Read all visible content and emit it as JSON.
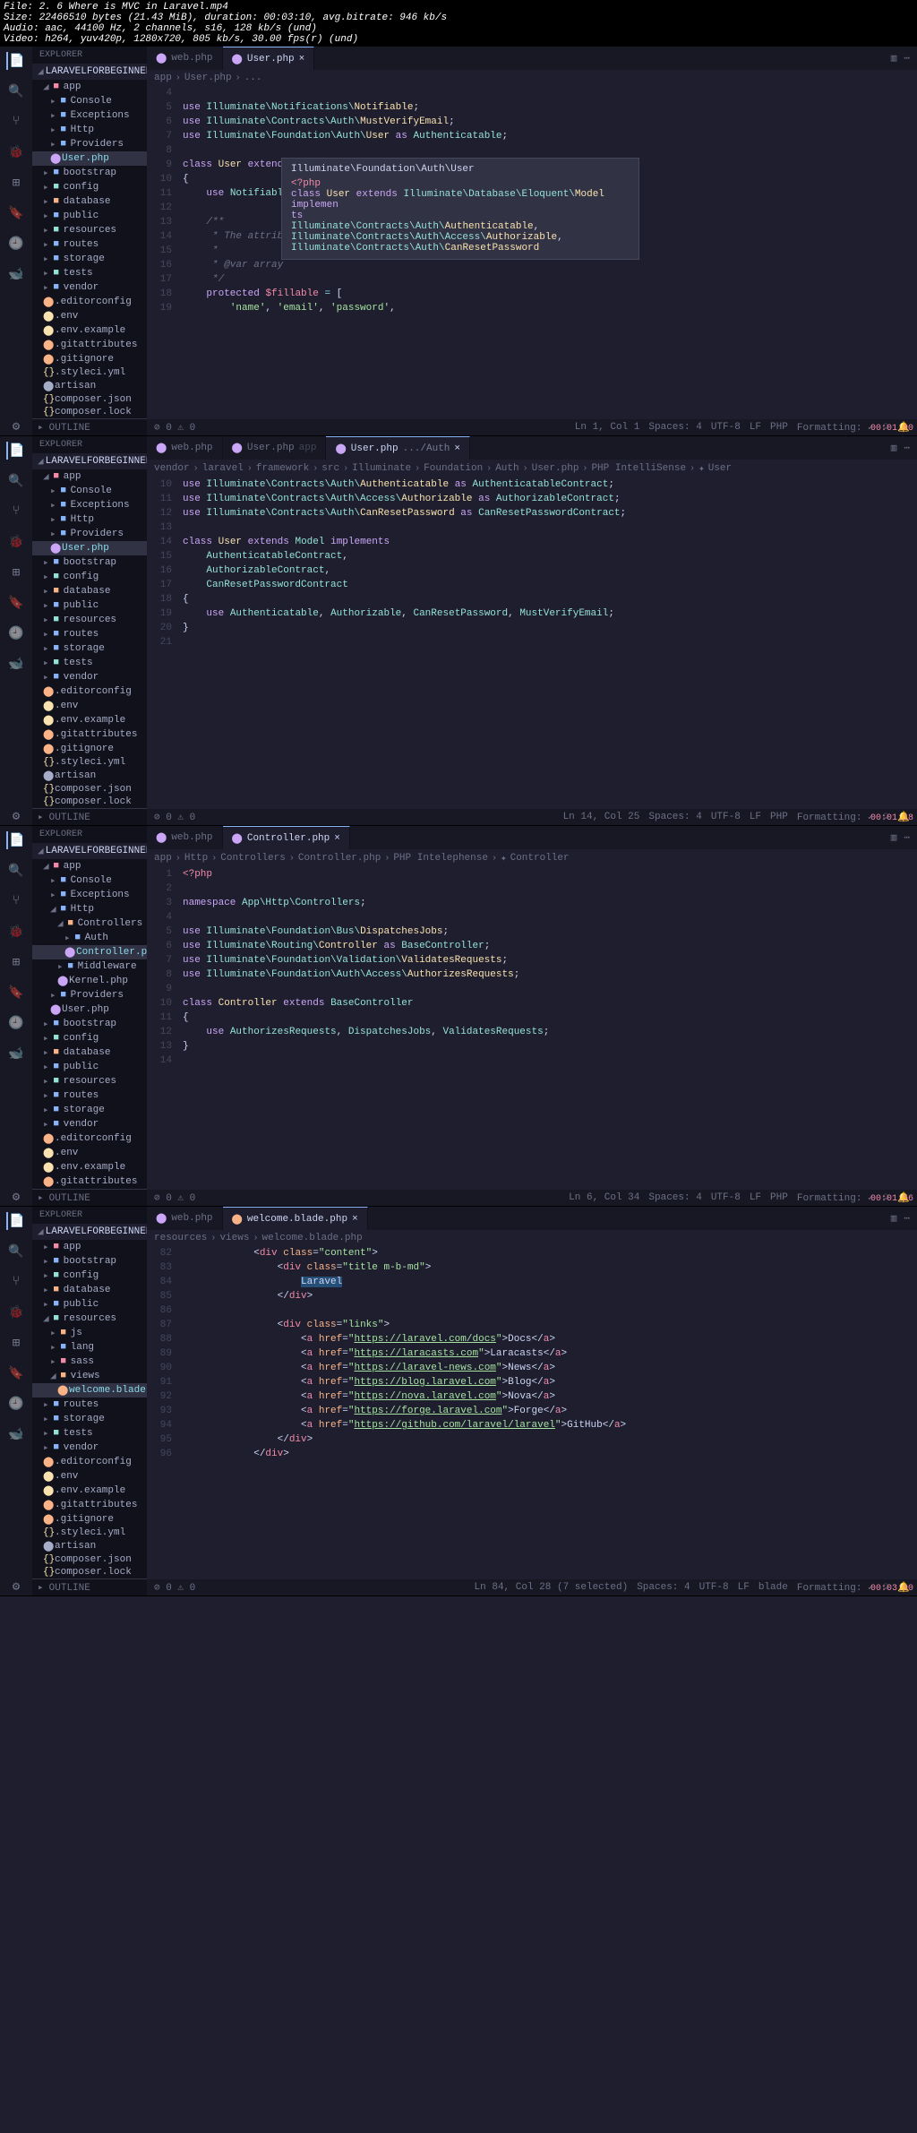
{
  "header": {
    "file": "File: 2. 6 Where is MVC in Laravel.mp4",
    "size": "Size: 22466510 bytes (21.43 MiB), duration: 00:03:10, avg.bitrate: 946 kb/s",
    "audio": "Audio: aac, 44100 Hz, 2 channels, s16, 128 kb/s (und)",
    "video": "Video: h264, yuv420p, 1280x720, 805 kb/s, 30.00 fps(r) (und)"
  },
  "common": {
    "explorer": "EXPLORER",
    "project": "LARAVELFORBEGINNER",
    "outline": "OUTLINE",
    "tab_web": "web.php"
  },
  "panel1": {
    "tab_active": "User.php",
    "breadcrumb": [
      "app",
      "User.php",
      "..."
    ],
    "tree": [
      "app",
      "Console",
      "Exceptions",
      "Http",
      "Providers",
      "User.php",
      "bootstrap",
      "config",
      "database",
      "public",
      "resources",
      "routes",
      "storage",
      "tests",
      "vendor",
      ".editorconfig",
      ".env",
      ".env.example",
      ".gitattributes",
      ".gitignore",
      ".styleci.yml",
      "artisan",
      "composer.json",
      "composer.lock"
    ],
    "lines": {
      "4": "",
      "5": "use Illuminate\\Notifications\\Notifiable;",
      "6": "use Illuminate\\Contracts\\Auth\\MustVerifyEmail;",
      "7": "use Illuminate\\Foundation\\Auth\\User as Authenticatable;",
      "8": "",
      "9": "class User extends Authenticatable",
      "10": "{",
      "11": "    use Notifiable;",
      "12": "",
      "13": "    /**",
      "14": "     * The attribut",
      "15": "     *",
      "16": "     * @var array",
      "17": "     */",
      "18": "    protected $fillable = [",
      "19": "        'name', 'email', 'password',"
    },
    "tooltip": {
      "title": "Illuminate\\Foundation\\Auth\\User",
      "php": "<?php",
      "l1": "class User extends Illuminate\\Database\\Eloquent\\Model implemen",
      "l2": "ts",
      "l3": "    Illuminate\\Contracts\\Auth\\Authenticatable,",
      "l4": "    Illuminate\\Contracts\\Auth\\Access\\Authorizable,",
      "l5": "    Illuminate\\Contracts\\Auth\\CanResetPassword"
    },
    "status": {
      "pos": "Ln 1, Col 1",
      "spaces": "Spaces: 4",
      "enc": "UTF-8",
      "eol": "LF",
      "lang": "PHP",
      "fmt": "Formatting: ✓",
      "time": "00:01:00",
      "err": "⊘ 0 ⚠ 0"
    }
  },
  "panel2": {
    "tab_user": "User.php",
    "tab_user_dim": "app",
    "tab_active": "User.php",
    "tab_active_dim": ".../Auth",
    "breadcrumb": [
      "vendor",
      "laravel",
      "framework",
      "src",
      "Illuminate",
      "Foundation",
      "Auth",
      "User.php",
      "PHP IntelliSense",
      "User"
    ],
    "tree": [
      "app",
      "Console",
      "Exceptions",
      "Http",
      "Providers",
      "User.php",
      "bootstrap",
      "config",
      "database",
      "public",
      "resources",
      "routes",
      "storage",
      "tests",
      "vendor",
      ".editorconfig",
      ".env",
      ".env.example",
      ".gitattributes",
      ".gitignore",
      ".styleci.yml",
      "artisan",
      "composer.json",
      "composer.lock"
    ],
    "lines": {
      "10": "use Illuminate\\Contracts\\Auth\\Authenticatable as AuthenticatableContract;",
      "11": "use Illuminate\\Contracts\\Auth\\Access\\Authorizable as AuthorizableContract;",
      "12": "use Illuminate\\Contracts\\Auth\\CanResetPassword as CanResetPasswordContract;",
      "13": "",
      "14": "class User extends Model implements",
      "15": "    AuthenticatableContract,",
      "16": "    AuthorizableContract,",
      "17": "    CanResetPasswordContract",
      "18": "{",
      "19": "    use Authenticatable, Authorizable, CanResetPassword, MustVerifyEmail;",
      "20": "}",
      "21": ""
    },
    "status": {
      "pos": "Ln 14, Col 25",
      "spaces": "Spaces: 4",
      "enc": "UTF-8",
      "eol": "LF",
      "lang": "PHP",
      "fmt": "Formatting: ✓",
      "time": "00:01:18",
      "err": "⊘ 0 ⚠ 0"
    }
  },
  "panel3": {
    "tab_active": "Controller.php",
    "breadcrumb": [
      "app",
      "Http",
      "Controllers",
      "Controller.php",
      "PHP Intelephense",
      "Controller"
    ],
    "tree": [
      "app",
      "Console",
      "Exceptions",
      "Http",
      "Controllers",
      "Auth",
      "Controller.php",
      "Middleware",
      "Kernel.php",
      "Providers",
      "User.php",
      "bootstrap",
      "config",
      "database",
      "public",
      "resources",
      "routes",
      "storage",
      "vendor",
      ".editorconfig",
      ".env",
      ".env.example",
      ".gitattributes"
    ],
    "lines": {
      "1": "<?php",
      "2": "",
      "3": "namespace App\\Http\\Controllers;",
      "4": "",
      "5": "use Illuminate\\Foundation\\Bus\\DispatchesJobs;",
      "6": "use Illuminate\\Routing\\Controller as BaseController;",
      "7": "use Illuminate\\Foundation\\Validation\\ValidatesRequests;",
      "8": "use Illuminate\\Foundation\\Auth\\Access\\AuthorizesRequests;",
      "9": "",
      "10": "class Controller extends BaseController",
      "11": "{",
      "12": "    use AuthorizesRequests, DispatchesJobs, ValidatesRequests;",
      "13": "}",
      "14": ""
    },
    "status": {
      "pos": "Ln 6, Col 34",
      "spaces": "Spaces: 4",
      "enc": "UTF-8",
      "eol": "LF",
      "lang": "PHP",
      "fmt": "Formatting: ✓",
      "time": "00:01:56",
      "err": "⊘ 0 ⚠ 0"
    }
  },
  "panel4": {
    "tab_active": "welcome.blade.php",
    "breadcrumb": [
      "resources",
      "views",
      "welcome.blade.php"
    ],
    "tree": [
      "app",
      "bootstrap",
      "config",
      "database",
      "public",
      "resources",
      "js",
      "lang",
      "sass",
      "views",
      "welcome.blade.php",
      "routes",
      "storage",
      "tests",
      "vendor",
      ".editorconfig",
      ".env",
      ".env.example",
      ".gitattributes",
      ".gitignore",
      ".styleci.yml",
      "artisan",
      "composer.json",
      "composer.lock"
    ],
    "lines": {
      "82": "<div class=\"content\">",
      "83": "    <div class=\"title m-b-md\">",
      "84": "        Laravel",
      "85": "    </div>",
      "86": "",
      "87": "    <div class=\"links\">",
      "88": "        <a href=\"https://laravel.com/docs\">Docs</a>",
      "89": "        <a href=\"https://laracasts.com\">Laracasts</a>",
      "90": "        <a href=\"https://laravel-news.com\">News</a>",
      "91": "        <a href=\"https://blog.laravel.com\">Blog</a>",
      "92": "        <a href=\"https://nova.laravel.com\">Nova</a>",
      "93": "        <a href=\"https://forge.laravel.com\">Forge</a>",
      "94": "        <a href=\"https://github.com/laravel/laravel\">GitHub</a>",
      "95": "    </div>",
      "96": "</div>"
    },
    "status": {
      "pos": "Ln 84, Col 28 (7 selected)",
      "spaces": "Spaces: 4",
      "enc": "UTF-8",
      "eol": "LF",
      "lang": "blade",
      "fmt": "Formatting: ✓",
      "time": "00:03:00",
      "err": "⊘ 0 ⚠ 0"
    }
  }
}
